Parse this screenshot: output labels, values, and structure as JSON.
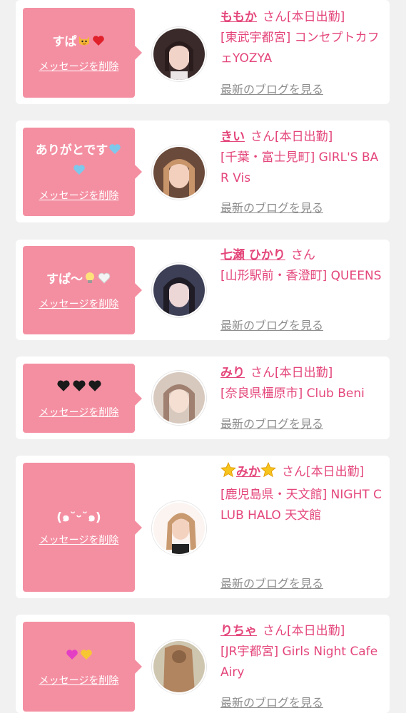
{
  "cards": [
    {
      "message_html": "すぱ",
      "message_icons": [
        "cat-face-icon",
        "red-heart-icon"
      ],
      "delete_label": "メッセージを削除",
      "name": "ももか",
      "name_prefix_icon": "",
      "name_suffix_icon": "",
      "suffix": "さん[本日出勤]",
      "shop": "[東武宇都宮] コンセプトカフェYOZYA",
      "blog_label": "最新のブログを見る",
      "avatar_color": "#3a2a2a"
    },
    {
      "message_html": "ありがとです",
      "message_icons": [
        "blue-heart-icon",
        "blue-heart-icon"
      ],
      "delete_label": "メッセージを削除",
      "name": "きい",
      "suffix": "さん[本日出勤]",
      "shop": "[千葉・富士見町] GIRL'S BAR Vis",
      "blog_label": "最新のブログを見る",
      "avatar_color": "#c89a78"
    },
    {
      "message_html": "すぱ〜",
      "message_icons": [
        "light-bulb-icon",
        "white-heart-icon"
      ],
      "delete_label": "メッセージを削除",
      "name": "七瀬 ひかり",
      "suffix": "さん",
      "shop": "[山形駅前・香澄町] QUEENS",
      "blog_label": "最新のブログを見る",
      "avatar_color": "#2d2c3a"
    },
    {
      "message_html": "",
      "message_icons": [
        "black-heart-icon",
        "black-heart-icon",
        "black-heart-icon"
      ],
      "delete_label": "メッセージを削除",
      "name": "みり",
      "suffix": "さん[本日出勤]",
      "shop": "[奈良県橿原市] Club Beni",
      "blog_label": "最新のブログを見る",
      "avatar_color": "#b89b8a"
    },
    {
      "message_html": "(๑˘ᵕ˘๑)",
      "message_icons": [],
      "delete_label": "メッセージを削除",
      "name": "みか",
      "name_prefix_icon": "star-icon",
      "name_suffix_icon": "star-icon",
      "suffix": "さん[本日出勤]",
      "shop": "[鹿児島県・天文館] NIGHT CLUB HALO 天文館",
      "blog_label": "最新のブログを見る",
      "avatar_color": "#d4a98a"
    },
    {
      "message_html": "",
      "message_icons": [
        "pink-heart-icon",
        "yellow-heart-icon"
      ],
      "delete_label": "メッセージを削除",
      "name": "りちゃ",
      "suffix": "さん[本日出勤]",
      "shop": "[JR宇都宮] Girls Night Cafe Airy",
      "blog_label": "最新のブログを見る",
      "avatar_color": "#b58c6a"
    }
  ],
  "colors": {
    "bubble": "#f48fa2",
    "accent": "#e4467a",
    "blog_link": "#8e8e8e",
    "page_bg": "#f1f1f1"
  }
}
